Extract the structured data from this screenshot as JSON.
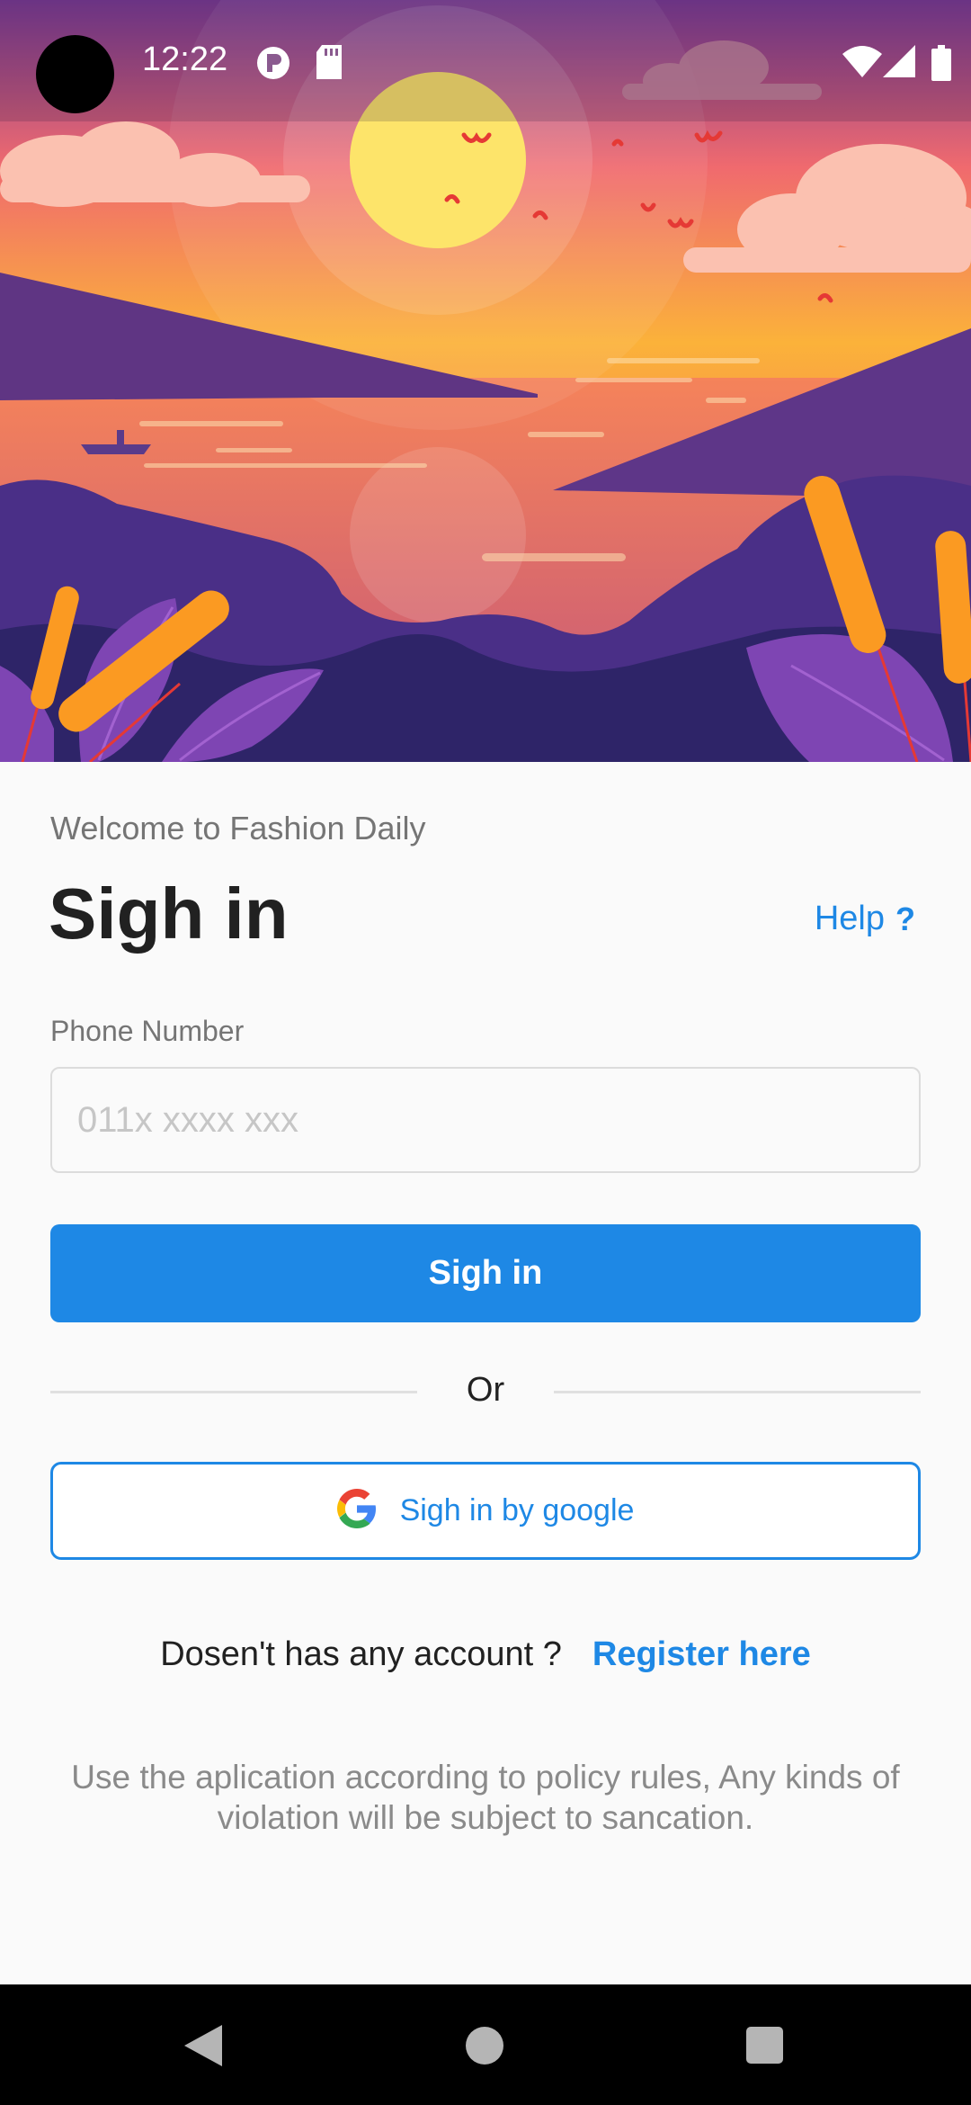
{
  "status_bar": {
    "time": "12:22",
    "icons": [
      "p-notification-icon",
      "sd-card-icon",
      "wifi-icon",
      "cell-signal-icon",
      "battery-icon"
    ]
  },
  "hero": {
    "description_icon": "sunset-landscape-illustration"
  },
  "login": {
    "welcome": "Welcome to Fashion Daily",
    "title": "Sigh in",
    "help_label": "Help",
    "help_icon": "?",
    "phone_label": "Phone Number",
    "phone_placeholder": "011x xxxx xxx",
    "phone_value": "",
    "signin_button": "Sigh in",
    "or_text": "Or",
    "google_button": "Sigh in by google",
    "no_account_text": "Dosen't has any account ?",
    "register_link": "Register here",
    "policy_text": "Use the aplication according to policy rules, Any kinds of violation will be subject to sancation."
  },
  "colors": {
    "accent": "#1e88e5",
    "background": "#fafafa",
    "title": "#212121",
    "muted": "#757575"
  },
  "nav_bar": {
    "icons": [
      "back-icon",
      "home-icon",
      "recents-icon"
    ]
  }
}
